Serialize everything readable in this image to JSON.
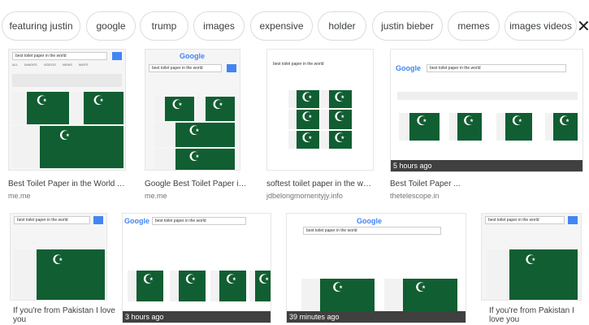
{
  "chips": [
    "featuring justin",
    "google",
    "trump",
    "images",
    "expensive",
    "holder",
    "justin bieber",
    "memes",
    "images videos"
  ],
  "close_glyph": "✕",
  "results": [
    {
      "title": "Best Toilet Paper in the World AL...",
      "source": "me.me",
      "badge": ""
    },
    {
      "title": "Google Best Toilet Paper in t...",
      "source": "me.me",
      "badge": ""
    },
    {
      "title": "softest toilet paper in the wor...",
      "source": "jdbelongmomentyjy.info",
      "badge": ""
    },
    {
      "title": "Best Toilet Paper ...",
      "source": "thetelescope.in",
      "badge": "5 hours ago"
    },
    {
      "title": "If you're from Pakistan I love you",
      "source": "",
      "badge": ""
    },
    {
      "title": "",
      "source": "",
      "badge": "3 hours ago"
    },
    {
      "title": "",
      "source": "",
      "badge": "39 minutes ago"
    },
    {
      "title": "If you're from Pakistan I love you",
      "source": "",
      "badge": ""
    }
  ],
  "mock": {
    "query": "best toilet paper in the world",
    "logo": "Google",
    "tabs": [
      "ALL",
      "IMAGES",
      "VIDEOS",
      "NEWS",
      "MAPS"
    ]
  },
  "colors": {
    "accent": "#4285f4",
    "flag_green": "#115e32"
  }
}
